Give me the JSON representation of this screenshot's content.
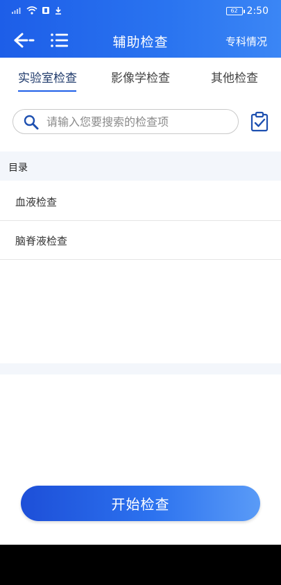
{
  "status_bar": {
    "time": "2:50",
    "battery_level": "62",
    "icons": [
      "signal-icon",
      "wifi-icon",
      "notification-icon",
      "download-icon",
      "battery-icon"
    ]
  },
  "navbar": {
    "title": "辅助检查",
    "right_link": "专科情况"
  },
  "tabs": [
    {
      "label": "实验室检查",
      "active": true
    },
    {
      "label": "影像学检查",
      "active": false
    },
    {
      "label": "其他检查",
      "active": false
    }
  ],
  "search": {
    "placeholder": "请输入您要搜索的检查项",
    "value": ""
  },
  "catalog": {
    "title": "目录",
    "items": [
      {
        "label": "血液检查"
      },
      {
        "label": "脑脊液检查"
      }
    ]
  },
  "start_button": {
    "label": "开始检查"
  },
  "colors": {
    "header_gradient_start": "#1d5ee8",
    "header_gradient_end": "#3b86f5",
    "active_tab_text": "#1f3a6b",
    "accent": "#1d5ee8"
  }
}
